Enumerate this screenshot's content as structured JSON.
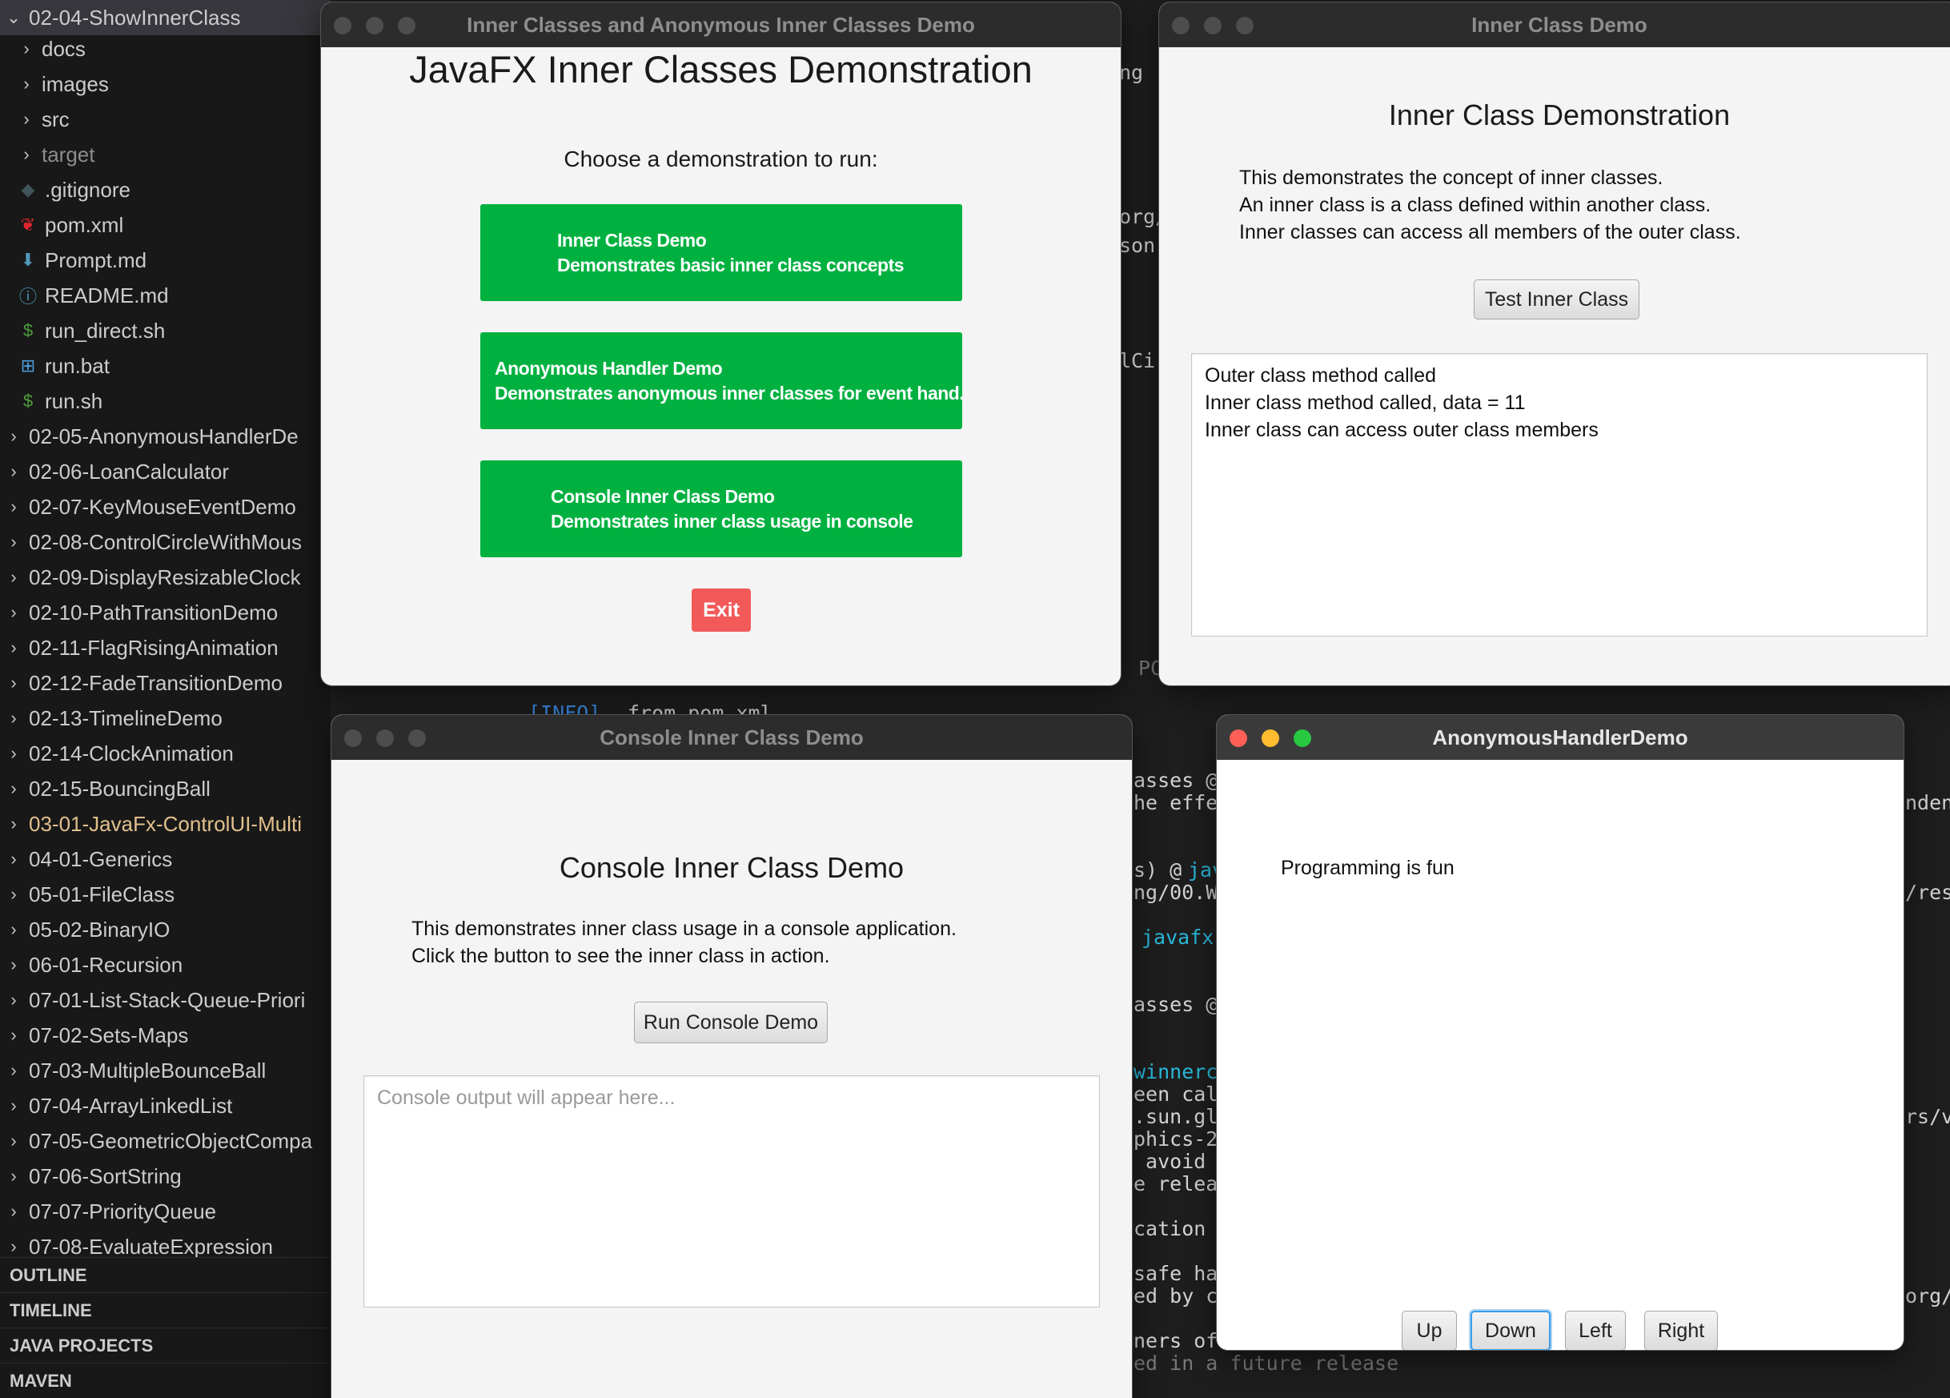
{
  "explorer": {
    "project_folder": "02-04-ShowInnerClass",
    "children": [
      {
        "label": "docs",
        "type": "folder"
      },
      {
        "label": "images",
        "type": "folder"
      },
      {
        "label": "src",
        "type": "folder"
      },
      {
        "label": "target",
        "type": "folder"
      },
      {
        "label": ".gitignore",
        "type": "file"
      },
      {
        "label": "pom.xml",
        "type": "file"
      },
      {
        "label": "Prompt.md",
        "type": "file"
      },
      {
        "label": "README.md",
        "type": "file"
      },
      {
        "label": "run_direct.sh",
        "type": "file"
      },
      {
        "label": "run.bat",
        "type": "file"
      },
      {
        "label": "run.sh",
        "type": "file"
      }
    ],
    "folders": [
      "02-05-AnonymousHandlerDe",
      "02-06-LoanCalculator",
      "02-07-KeyMouseEventDemo",
      "02-08-ControlCircleWithMous",
      "02-09-DisplayResizableClock",
      "02-10-PathTransitionDemo",
      "02-11-FlagRisingAnimation",
      "02-12-FadeTransitionDemo",
      "02-13-TimelineDemo",
      "02-14-ClockAnimation",
      "02-15-BouncingBall",
      "03-01-JavaFx-ControlUI-Multi",
      "04-01-Generics",
      "05-01-FileClass",
      "05-02-BinaryIO",
      "06-01-Recursion",
      "07-01-List-Stack-Queue-Priori",
      "07-02-Sets-Maps",
      "07-03-MultipleBounceBall",
      "07-04-ArrayLinkedList",
      "07-05-GeometricObjectCompa",
      "07-06-SortString",
      "07-07-PriorityQueue",
      "07-08-EvaluateExpression"
    ],
    "sections": [
      "OUTLINE",
      "TIMELINE",
      "JAVA PROJECTS",
      "MAVEN"
    ]
  },
  "terminal": {
    "fragments": [
      "ng :",
      "org/",
      "son",
      "lCi",
      "PC",
      "[INFO]",
      "from pom.xml",
      "asses @",
      "he effe",
      "s) @",
      "jav",
      "ng/00.Wo",
      "javafx-",
      "asses @",
      "winnercl",
      "een call",
      ".sun.gla",
      "phics-21",
      " avoid a",
      "e releas",
      "cation l",
      "safe has",
      "ed by co",
      "ners of",
      "ed in a future release",
      "nden",
      "/res",
      "rs/v",
      "org/"
    ]
  },
  "main_window": {
    "title": "Inner Classes and Anonymous Inner Classes Demo",
    "heading": "JavaFX Inner Classes Demonstration",
    "prompt": "Choose a demonstration to run:",
    "buttons": [
      {
        "line1": "Inner Class Demo",
        "line2": "Demonstrates basic inner class concepts"
      },
      {
        "line1": "Anonymous Handler Demo",
        "line2": "Demonstrates anonymous inner classes for event hand..."
      },
      {
        "line1": "Console Inner Class Demo",
        "line2": "Demonstrates inner class usage in console"
      }
    ],
    "exit_label": "Exit",
    "colors": {
      "button_green": "#00b140",
      "exit_red": "#f25a5a"
    }
  },
  "inner_window": {
    "title": "Inner Class Demo",
    "heading": "Inner Class Demonstration",
    "description": [
      "This demonstrates the concept of inner classes.",
      "An inner class is a class defined within another class.",
      "Inner classes can access all members of the outer class."
    ],
    "button_label": "Test Inner Class",
    "output": [
      "Outer class method called",
      "Inner class method called, data = 11",
      "Inner class can access outer class members"
    ]
  },
  "console_window": {
    "title": "Console Inner Class Demo",
    "heading": "Console Inner Class Demo",
    "description": [
      "This demonstrates inner class usage in a console application.",
      "Click the button to see the inner class in action."
    ],
    "button_label": "Run Console Demo",
    "output_placeholder": "Console output will appear here..."
  },
  "anon_window": {
    "title": "AnonymousHandlerDemo",
    "message": "Programming is fun",
    "buttons": [
      "Up",
      "Down",
      "Left",
      "Right"
    ],
    "focused_button": "Down"
  }
}
